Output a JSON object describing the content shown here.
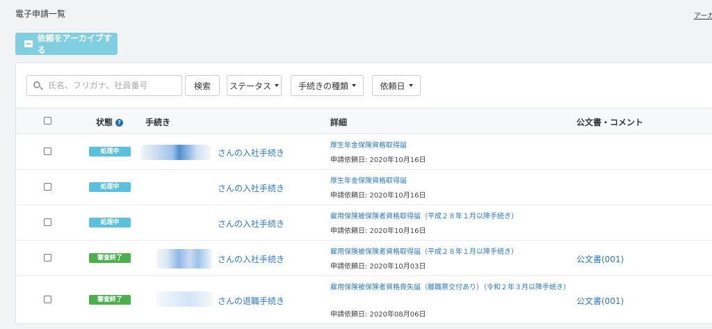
{
  "page": {
    "title": "電子申請一覧",
    "archive_link": "アーカイブ"
  },
  "toolbar": {
    "archive_button": "依頼をアーカイブする"
  },
  "filters": {
    "search_placeholder": "氏名、フリガナ、社員番号",
    "search_button": "検索",
    "status_dropdown": "ステータス",
    "procedure_type_dropdown": "手続きの種類",
    "request_date_dropdown": "依頼日"
  },
  "table": {
    "headers": {
      "status": "状態",
      "procedure": "手続き",
      "detail": "詳細",
      "document": "公文書・コメント"
    },
    "rows": [
      {
        "status": "処理中",
        "status_type": "processing",
        "procedure": "さんの入社手続き",
        "detail": "厚生年金保険資格取得届",
        "date": "申請依頼日: 2020年10月16日",
        "document": ""
      },
      {
        "status": "処理中",
        "status_type": "processing",
        "procedure": "さんの入社手続き",
        "detail": "厚生年金保険資格取得届",
        "date": "申請依頼日: 2020年10月16日",
        "document": ""
      },
      {
        "status": "処理中",
        "status_type": "processing",
        "procedure": "さんの入社手続き",
        "detail": "雇用保険被保険者資格取得届（平成２８年１月以降手続き）",
        "date": "申請依頼日: 2020年10月16日",
        "document": ""
      },
      {
        "status": "審査終了",
        "status_type": "done",
        "procedure": "さんの入社手続き",
        "detail": "雇用保険被保険者資格取得届（平成２８年１月以降手続き）",
        "date": "申請依頼日: 2020年10月03日",
        "document": "公文書(001)"
      },
      {
        "status": "審査終了",
        "status_type": "done",
        "procedure": "さんの退職手続き",
        "detail": "雇用保険被保険者資格喪失届（離職票交付あり）（令和２年３月以降手続き）",
        "date": "申請依頼日: 2020年08月06日",
        "document": "公文書(001)"
      }
    ]
  },
  "colors": {
    "processing": "#5bc0de",
    "done": "#4cae4c",
    "link": "#2a78c2",
    "archive_button": "#7fcfe0"
  }
}
